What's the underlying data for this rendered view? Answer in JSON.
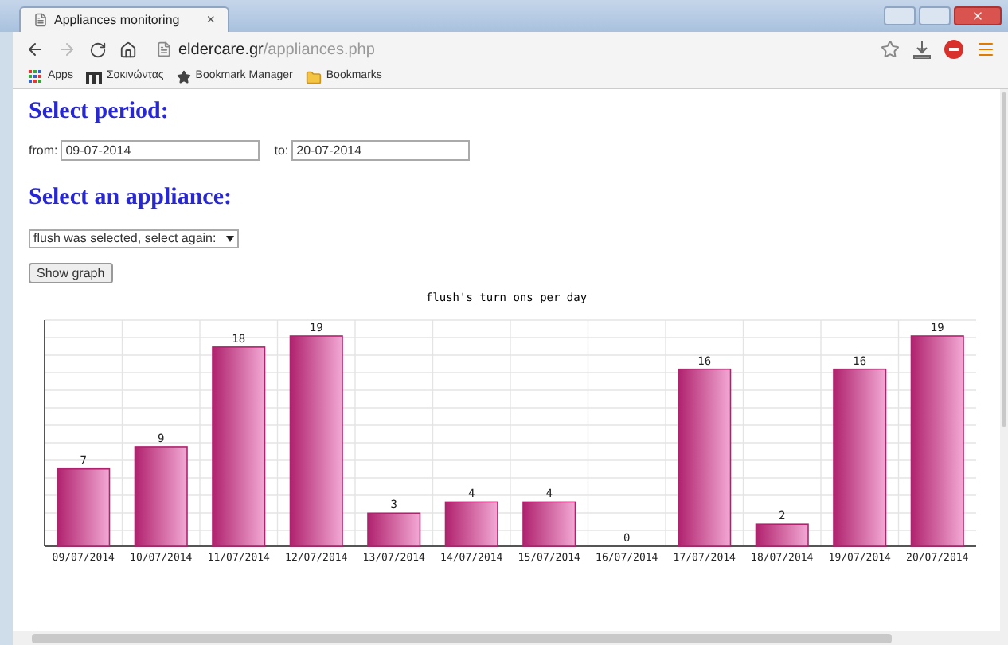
{
  "browser": {
    "tab_title": "Appliances monitoring",
    "tab_close": "×",
    "url_host": "eldercare.gr",
    "url_path": "/appliances.php",
    "bookmarks": [
      {
        "label": "Apps",
        "kind": "apps"
      },
      {
        "label": "Σοκινώντας",
        "kind": "m"
      },
      {
        "label": "Bookmark Manager",
        "kind": "star"
      },
      {
        "label": "Bookmarks",
        "kind": "folder"
      }
    ]
  },
  "period": {
    "heading": "Select period:",
    "from_label": "from:",
    "from_value": "09-07-2014",
    "to_label": "to:",
    "to_value": "20-07-2014"
  },
  "appliance": {
    "heading": "Select an appliance:",
    "select_value": "flush was selected, select again:",
    "button": "Show graph"
  },
  "chart_data": {
    "type": "bar",
    "title": "flush's turn ons per day",
    "categories": [
      "09/07/2014",
      "10/07/2014",
      "11/07/2014",
      "12/07/2014",
      "13/07/2014",
      "14/07/2014",
      "15/07/2014",
      "16/07/2014",
      "17/07/2014",
      "18/07/2014",
      "19/07/2014",
      "20/07/2014"
    ],
    "series": [
      {
        "color": "#b0226e",
        "values": [
          7,
          9,
          18,
          19,
          3,
          4,
          4,
          0,
          16,
          2,
          16,
          19
        ]
      }
    ],
    "data_labels": true
  }
}
